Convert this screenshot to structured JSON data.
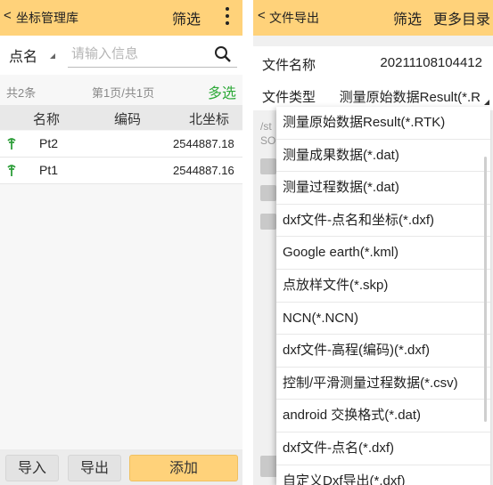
{
  "left": {
    "header": {
      "back": "<",
      "title": "坐标管理库",
      "filter": "筛选"
    },
    "search": {
      "field": "点名",
      "placeholder": "请输入信息"
    },
    "info": {
      "count": "共2条",
      "page": "第1页/共1页",
      "multi_select": "多选"
    },
    "table": {
      "columns": [
        "名称",
        "编码",
        "北坐标"
      ],
      "rows": [
        {
          "name": "Pt2",
          "code": "",
          "north": "2544887.18"
        },
        {
          "name": "Pt1",
          "code": "",
          "north": "2544887.16"
        }
      ]
    },
    "buttons": {
      "import": "导入",
      "export": "导出",
      "add": "添加"
    }
  },
  "right": {
    "header": {
      "back": "<",
      "title": "文件导出",
      "filter": "筛选",
      "more": "更多目录"
    },
    "props": {
      "file_name_label": "文件名称",
      "file_name_value": "20211108104412",
      "file_type_label": "文件类型",
      "file_type_value": "测量原始数据Result(*.R"
    },
    "path_text": [
      "/st",
      "SO"
    ],
    "dropdown": [
      "测量原始数据Result(*.RTK)",
      "测量成果数据(*.dat)",
      "测量过程数据(*.dat)",
      "dxf文件-点名和坐标(*.dxf)",
      "Google earth(*.kml)",
      "点放样文件(*.skp)",
      "NCN(*.NCN)",
      "dxf文件-高程(编码)(*.dxf)",
      "控制/平滑测量过程数据(*.csv)",
      "android 交换格式(*.dat)",
      "dxf文件-点名(*.dxf)",
      "自定义Dxf导出(*.dxf)"
    ]
  },
  "colors": {
    "accent": "#ffd27a",
    "link_green": "#2faa3a",
    "pin_green": "#2e9e3a"
  }
}
